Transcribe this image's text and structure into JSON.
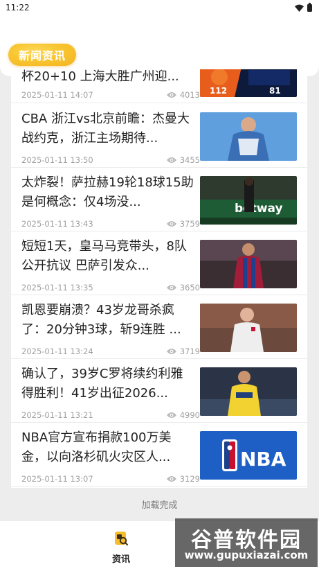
{
  "status_bar": {
    "time": "11:22"
  },
  "header": {
    "title": "新闻资讯"
  },
  "news": [
    {
      "title": "杯20+10 上海大胜广州迎...",
      "date": "2025-01-11 14:07",
      "views": "4013",
      "thumb": "basketball-scoreboard"
    },
    {
      "title": "CBA 浙江vs北京前瞻：杰曼大战约克，浙江主场期待...",
      "date": "2025-01-11 13:50",
      "views": "3455",
      "thumb": "basketball-player"
    },
    {
      "title": "太炸裂！萨拉赫19轮18球15助是何概念：仅4场没...",
      "date": "2025-01-11 13:43",
      "views": "3759",
      "thumb": "football-betway"
    },
    {
      "title": "短短1天，皇马马竞带头，8队公开抗议 巴萨引发众...",
      "date": "2025-01-11 13:35",
      "views": "3650",
      "thumb": "football-barca"
    },
    {
      "title": "凯恩要崩溃？43岁龙哥杀疯了：20分钟3球，斩9连胜 ...",
      "date": "2025-01-11 13:24",
      "views": "3719",
      "thumb": "football-bayern"
    },
    {
      "title": "确认了，39岁C罗将续约利雅得胜利！41岁出征2026...",
      "date": "2025-01-11 13:21",
      "views": "4990",
      "thumb": "football-alnassr"
    },
    {
      "title": "NBA官方宣布捐款100万美金，以向洛杉矶火灾区人...",
      "date": "2025-01-11 13:07",
      "views": "3129",
      "thumb": "nba-logo"
    }
  ],
  "thumb_text": {
    "score_left": "112",
    "score_right": "81",
    "nba": "NBA",
    "betway": "betway"
  },
  "footer": {
    "status": "加载完成"
  },
  "bottom_nav": {
    "tab_label": "资讯"
  },
  "watermark": {
    "title": "谷普软件园",
    "url": "www.gupuxiazai.com"
  },
  "colors": {
    "accent": "#f6bd2c",
    "nba_blue": "#1d5fc4",
    "text": "#222222",
    "meta": "#a0a0a0"
  }
}
